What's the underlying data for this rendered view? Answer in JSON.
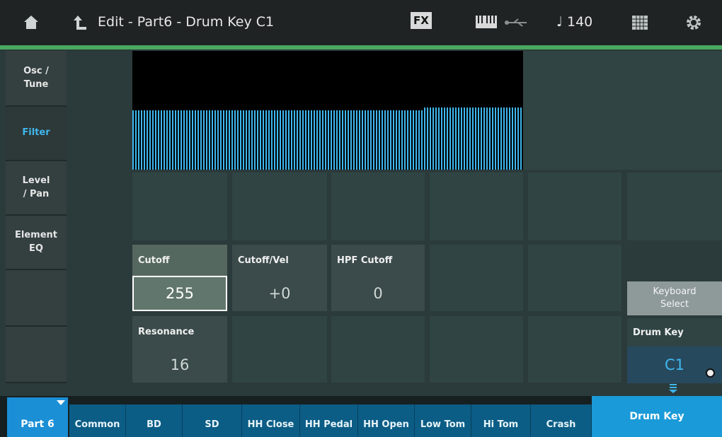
{
  "header": {
    "title": "Edit - Part6 - Drum Key C1",
    "fx_label": "FX",
    "tempo": "♩ 140",
    "icons": [
      "home-icon",
      "back-arrow-icon",
      "keyboard-icon",
      "usb-icon",
      "grid-icon",
      "gear-icon"
    ]
  },
  "left_tabs": [
    {
      "label": "Osc /\nTune",
      "active": false
    },
    {
      "label": "Filter",
      "active": true
    },
    {
      "label": "Level\n/ Pan",
      "active": false
    },
    {
      "label": "Element\nEQ",
      "active": false
    }
  ],
  "params": {
    "cutoff": {
      "label": "Cutoff",
      "value": "255"
    },
    "cutoff_vel": {
      "label": "Cutoff/Vel",
      "value": "+0"
    },
    "hpf_cutoff": {
      "label": "HPF Cutoff",
      "value": "0"
    },
    "resonance": {
      "label": "Resonance",
      "value": "16"
    }
  },
  "right_panel": {
    "keyboard_select": "Keyboard\nSelect",
    "drum_key_label": "Drum Key",
    "drum_key_value": "C1"
  },
  "bottom_tabs": {
    "part": "Part 6",
    "keys": [
      "Common",
      "BD",
      "SD",
      "HH Close",
      "HH Pedal",
      "HH Open",
      "Low Tom",
      "Hi Tom",
      "Crash"
    ],
    "drum_key": "Drum Key"
  },
  "colors": {
    "accent": "#1a9ad8",
    "header_line": "#4aa860",
    "active_tab_text": "#3fb7ee",
    "waveform": "#3fb7ee"
  }
}
